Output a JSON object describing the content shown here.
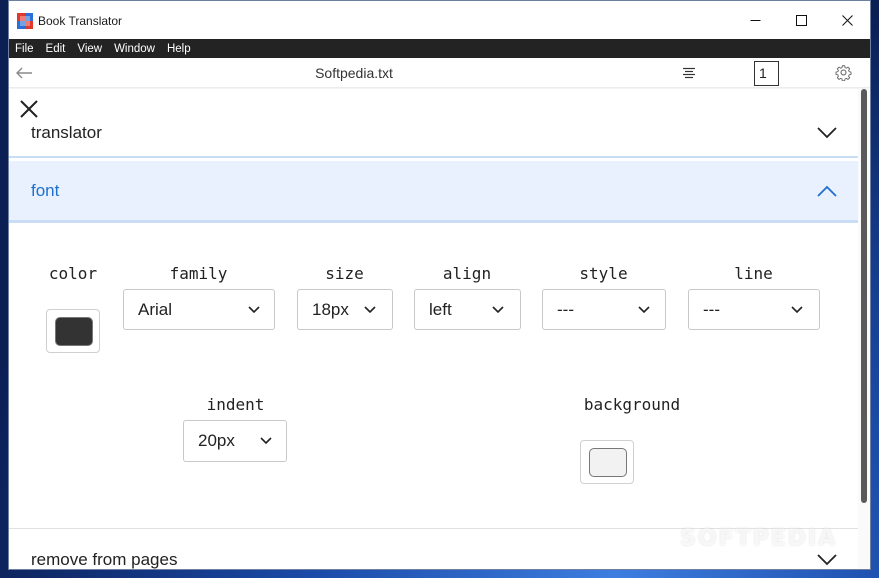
{
  "window": {
    "title": "Book Translator"
  },
  "menu": [
    "File",
    "Edit",
    "View",
    "Window",
    "Help"
  ],
  "toolbar": {
    "file_name": "Softpedia.txt",
    "page_number": "1"
  },
  "sections": {
    "translator": "translator",
    "font": "font",
    "remove": "remove from pages"
  },
  "font_settings": {
    "color_label": "color",
    "family_label": "family",
    "family_value": "Arial",
    "size_label": "size",
    "size_value": "18px",
    "align_label": "align",
    "align_value": "left",
    "style_label": "style",
    "style_value": "---",
    "line_label": "line",
    "line_value": "---",
    "indent_label": "indent",
    "indent_value": "20px",
    "background_label": "background"
  },
  "colors": {
    "text_color_swatch": "#333333",
    "background_swatch": "#f2f2f2",
    "accent": "#1f6fd1",
    "section_highlight": "#e8f1fd"
  },
  "watermark": "SOFTPEDIA"
}
